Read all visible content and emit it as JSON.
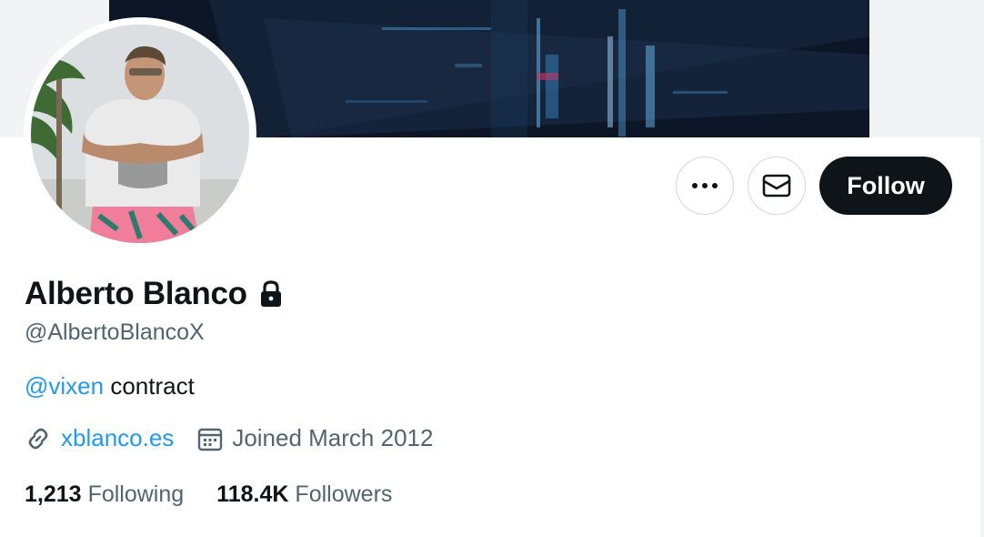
{
  "profile": {
    "display_name": "Alberto Blanco",
    "handle": "@AlbertoBlancoX",
    "bio_mention": "@vixen",
    "bio_text": " contract",
    "website": "xblanco.es",
    "joined": "Joined March 2012",
    "following_count": "1,213",
    "following_label": "Following",
    "followers_count": "118.4K",
    "followers_label": "Followers"
  },
  "actions": {
    "follow_label": "Follow"
  },
  "icons": {
    "lock": "lock-icon",
    "more": "more-dots-icon",
    "message": "envelope-icon",
    "link": "link-icon",
    "calendar": "calendar-icon"
  },
  "colors": {
    "accent": "#1d9bf0",
    "text_primary": "#0f1419",
    "text_secondary": "#536471",
    "follow_bg": "#0f1419"
  }
}
